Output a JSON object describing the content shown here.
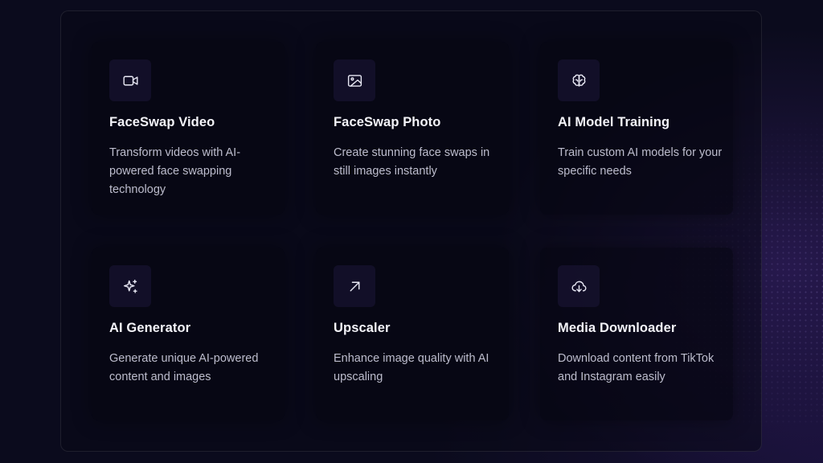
{
  "features": [
    {
      "icon": "video-icon",
      "title": "FaceSwap Video",
      "description": "Transform videos with AI-powered face swapping technology"
    },
    {
      "icon": "image-icon",
      "title": "FaceSwap Photo",
      "description": "Create stunning face swaps in still images instantly"
    },
    {
      "icon": "brain-icon",
      "title": "AI Model Training",
      "description": "Train custom AI models for your specific needs"
    },
    {
      "icon": "sparkles-icon",
      "title": "AI Generator",
      "description": "Generate unique AI-powered content and images"
    },
    {
      "icon": "arrow-up-right-icon",
      "title": "Upscaler",
      "description": "Enhance image quality with AI upscaling"
    },
    {
      "icon": "cloud-download-icon",
      "title": "Media Downloader",
      "description": "Download content from TikTok and Instagram easily"
    }
  ],
  "colors": {
    "background": "#0b0b1d",
    "card": "#08081a",
    "icon_box": "#1c1838",
    "title": "#f3f3f8",
    "description": "#bdbdcd"
  }
}
